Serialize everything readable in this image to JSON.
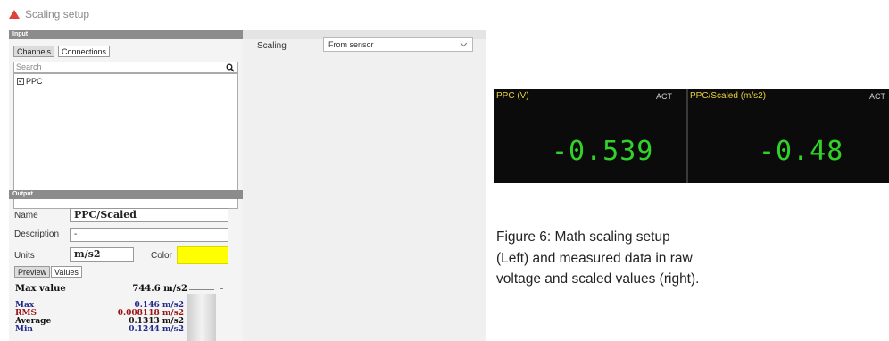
{
  "window": {
    "title": "Scaling setup",
    "icon": "warning-triangle-icon"
  },
  "input": {
    "header": "Input",
    "tabs": [
      "Channels",
      "Connections"
    ],
    "search_placeholder": "Search",
    "channels": [
      {
        "label": "PPC",
        "checked": true
      }
    ]
  },
  "output": {
    "header": "Output",
    "name_label": "Name",
    "name_value": "PPC/Scaled",
    "description_label": "Description",
    "description_value": "-",
    "units_label": "Units",
    "units_value": "m/s2",
    "color_label": "Color",
    "color_value": "#ffff00",
    "tabs": [
      "Preview",
      "Values"
    ],
    "max_value_label": "Max value",
    "max_value": "744.6 m/s2",
    "stats": [
      {
        "label": "Max",
        "value": "0.146 m/s2",
        "color": "#1f2a8a"
      },
      {
        "label": "RMS",
        "value": "0.008118 m/s2",
        "color": "#9a1414"
      },
      {
        "label": "Average",
        "value": "0.1313 m/s2",
        "color": "#111111"
      },
      {
        "label": "Min",
        "value": "0.1244 m/s2",
        "color": "#1f2a8a"
      }
    ]
  },
  "scaling": {
    "label": "Scaling",
    "selected": "From sensor"
  },
  "monitor": {
    "panels": [
      {
        "title": "PPC (V)",
        "status": "ACT",
        "value": "-0.539"
      },
      {
        "title": "PPC/Scaled (m/s2)",
        "status": "ACT",
        "value": "-0.48"
      }
    ],
    "accent": "#32d12a"
  },
  "caption": {
    "line1": "Figure 6: Math scaling setup",
    "line2": "(Left) and measured data in raw",
    "line3": "voltage and scaled values (right)."
  }
}
